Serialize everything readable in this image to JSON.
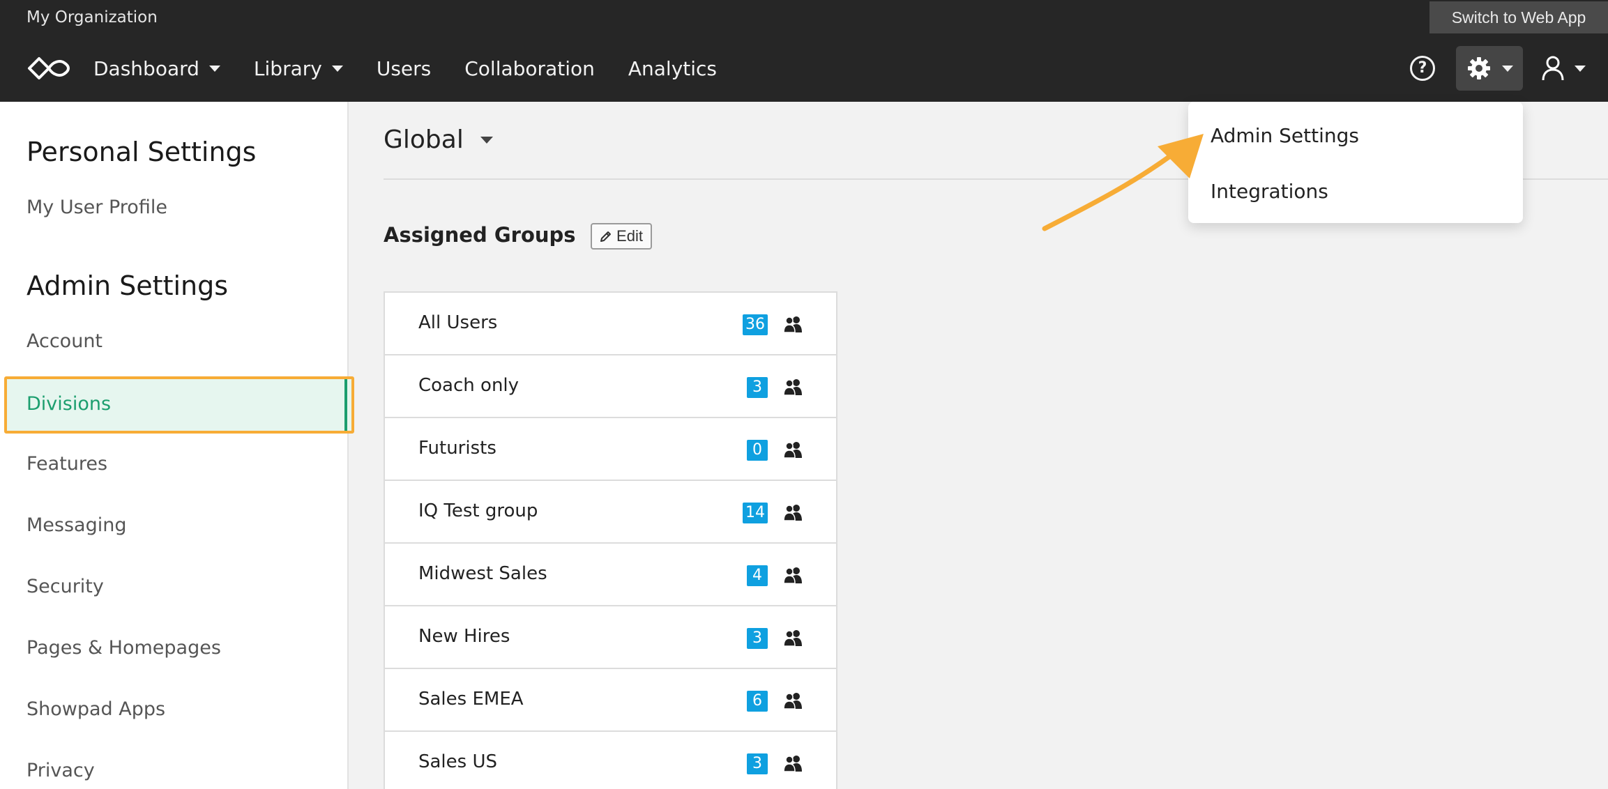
{
  "header": {
    "org_name": "My Organization",
    "switch_label": "Switch to Web App",
    "nav": [
      {
        "label": "Dashboard",
        "has_caret": true
      },
      {
        "label": "Library",
        "has_caret": true
      },
      {
        "label": "Users",
        "has_caret": false
      },
      {
        "label": "Collaboration",
        "has_caret": false
      },
      {
        "label": "Analytics",
        "has_caret": false
      }
    ],
    "help_glyph": "?",
    "icons": [
      "logo-icon",
      "help-icon",
      "gear-icon",
      "user-icon"
    ]
  },
  "sidebar": {
    "personal_heading": "Personal Settings",
    "profile_item": "My User Profile",
    "admin_heading": "Admin Settings",
    "items": [
      "Account",
      "Divisions",
      "Features",
      "Messaging",
      "Security",
      "Pages & Homepages",
      "Showpad Apps",
      "Privacy"
    ],
    "active_item": "Divisions"
  },
  "main": {
    "title": "Global",
    "assigned_title": "Assigned Groups",
    "edit_label": "Edit",
    "groups": [
      {
        "name": "All Users",
        "count": "36"
      },
      {
        "name": "Coach only",
        "count": "3"
      },
      {
        "name": "Futurists",
        "count": "0"
      },
      {
        "name": "IQ Test group",
        "count": "14"
      },
      {
        "name": "Midwest Sales",
        "count": "4"
      },
      {
        "name": "New Hires",
        "count": "3"
      },
      {
        "name": "Sales EMEA",
        "count": "6"
      },
      {
        "name": "Sales US",
        "count": "3"
      }
    ]
  },
  "dropdown": {
    "items": [
      "Admin Settings",
      "Integrations"
    ]
  },
  "colors": {
    "topbar": "#262626",
    "accent_green": "#1b9e6e",
    "highlight_orange": "#f7ac36",
    "badge_blue": "#0fa0e0"
  }
}
